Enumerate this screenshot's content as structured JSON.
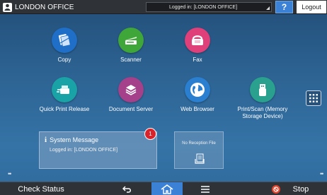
{
  "topbar": {
    "office_name": "LONDON OFFICE",
    "login_status": "Logged in: [LONDON OFFICE]",
    "help_label": "?",
    "logout_label": "Logout"
  },
  "apps": [
    {
      "label": "Copy",
      "icon": "copy-icon",
      "color": "#1f6fc8"
    },
    {
      "label": "Scanner",
      "icon": "scanner-icon",
      "color": "#3fa63a"
    },
    {
      "label": "Fax",
      "icon": "fax-icon",
      "color": "#e0407a"
    },
    {
      "label": "Quick Print Release",
      "icon": "quick-print-release-icon",
      "color": "#19a3a6"
    },
    {
      "label": "Document Server",
      "icon": "document-server-icon",
      "color": "#a5408a"
    },
    {
      "label": "Web Browser",
      "icon": "web-browser-icon",
      "color": "#2a7fd0"
    },
    {
      "label": "Print/Scan (Memory\nStorage Device)",
      "icon": "usb-storage-icon",
      "color": "#2aa08e"
    }
  ],
  "widgets": {
    "system_message": {
      "title": "System Message",
      "body": "Logged in: [LONDON OFFICE]",
      "badge_count": "1"
    },
    "reception_file": {
      "label": "No Reception File"
    }
  },
  "bottombar": {
    "check_status_label": "Check Status",
    "stop_label": "Stop"
  },
  "colors": {
    "accent": "#3b82d6",
    "badge": "#d8232a",
    "stop": "#e2452e"
  }
}
